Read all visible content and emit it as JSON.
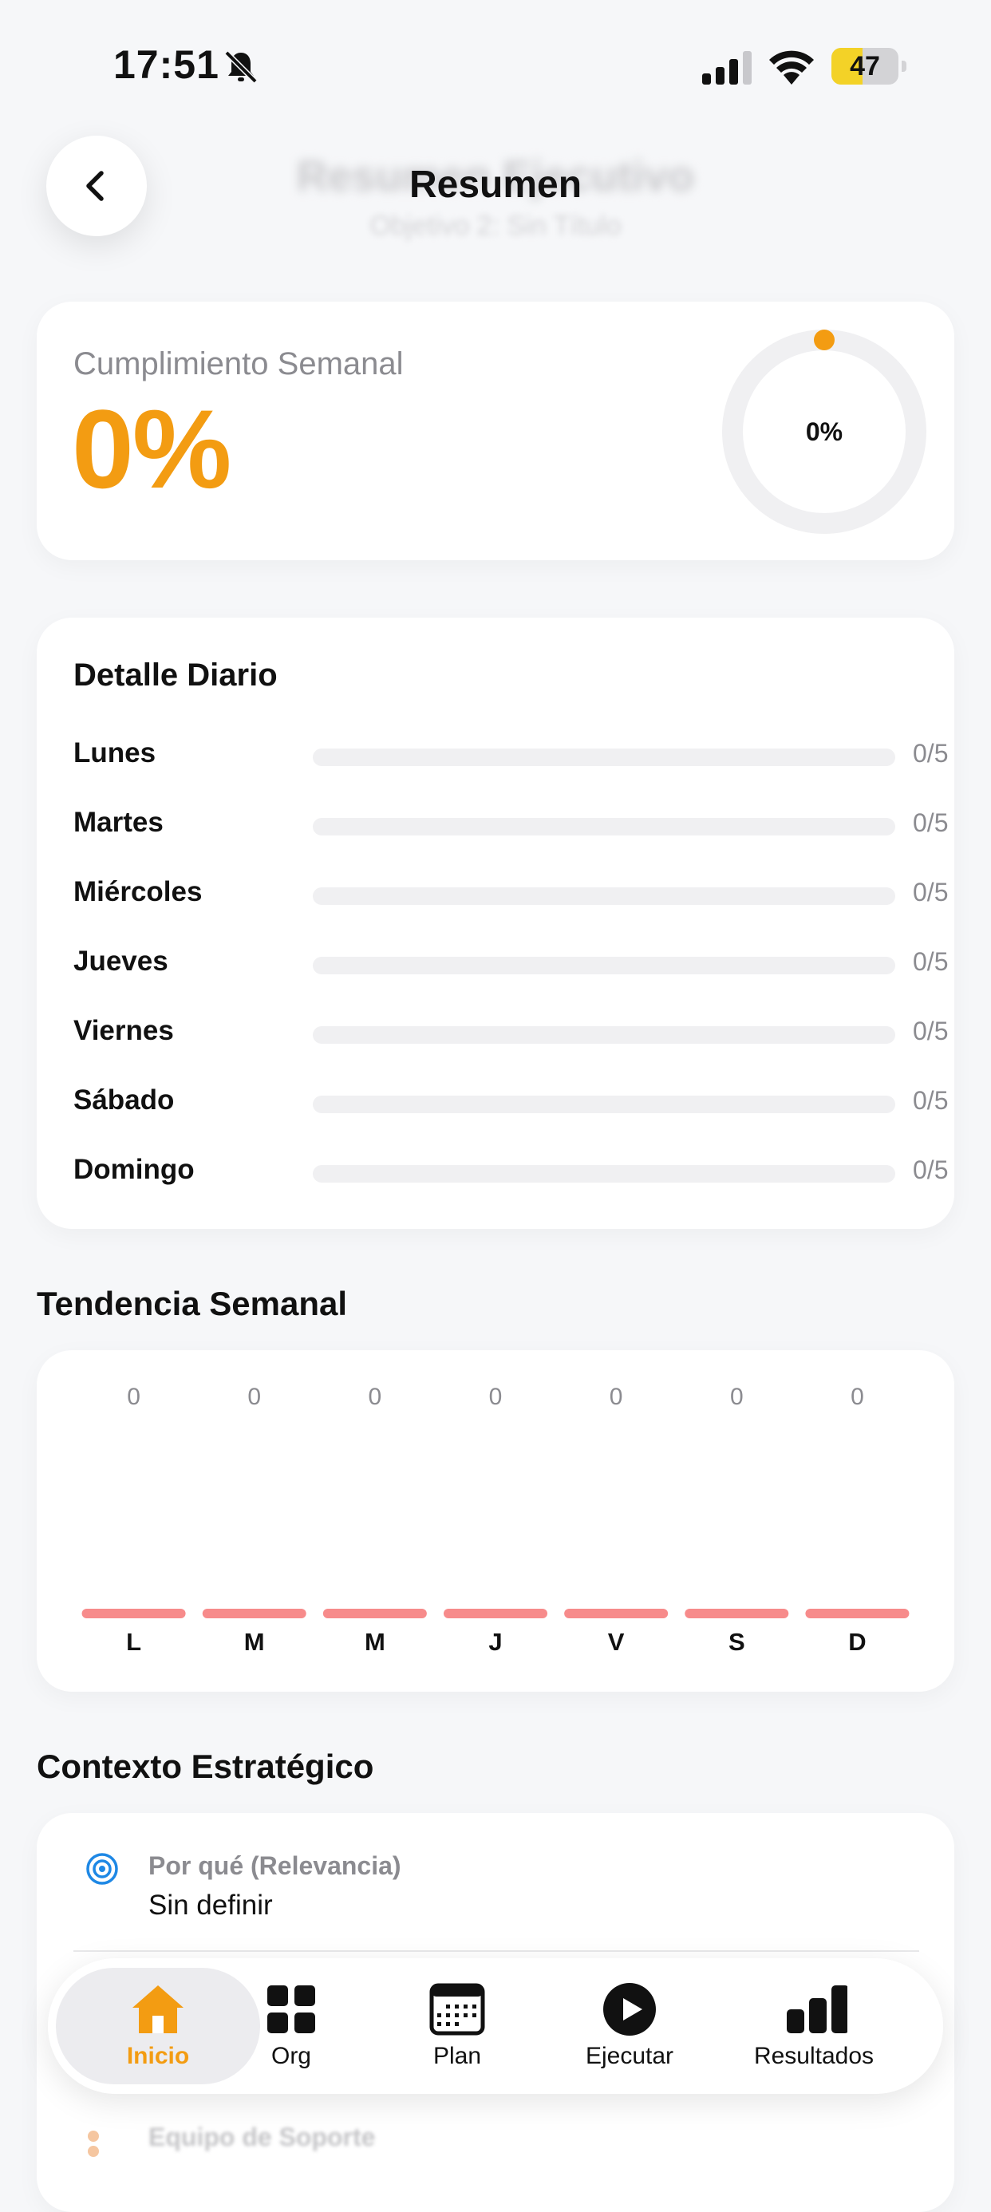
{
  "status_bar": {
    "time": "17:51",
    "battery": "47",
    "battery_level": 0.47
  },
  "header": {
    "title": "Resumen",
    "underlay_title": "Resumen Ejecutivo",
    "underlay_subtitle": "Objetivo 2: Sin Título"
  },
  "weekly": {
    "label": "Cumplimiento Semanal",
    "value": "0%",
    "ring_label": "0%",
    "ring_fraction": 0
  },
  "daily": {
    "title": "Detalle Diario",
    "rows": [
      {
        "day": "Lunes",
        "count": "0/5",
        "fraction": 0
      },
      {
        "day": "Martes",
        "count": "0/5",
        "fraction": 0
      },
      {
        "day": "Miércoles",
        "count": "0/5",
        "fraction": 0
      },
      {
        "day": "Jueves",
        "count": "0/5",
        "fraction": 0
      },
      {
        "day": "Viernes",
        "count": "0/5",
        "fraction": 0
      },
      {
        "day": "Sábado",
        "count": "0/5",
        "fraction": 0
      },
      {
        "day": "Domingo",
        "count": "0/5",
        "fraction": 0
      }
    ]
  },
  "trend": {
    "title": "Tendencia Semanal",
    "bar_color": "#f78b8b"
  },
  "chart_data": {
    "type": "bar",
    "categories": [
      "L",
      "M",
      "M",
      "J",
      "V",
      "S",
      "D"
    ],
    "values": [
      0,
      0,
      0,
      0,
      0,
      0,
      0
    ],
    "value_labels": [
      "0",
      "0",
      "0",
      "0",
      "0",
      "0",
      "0"
    ]
  },
  "context": {
    "title": "Contexto Estratégico",
    "items": [
      {
        "label": "Por qué (Relevancia)",
        "value": "Sin definir"
      }
    ],
    "faded_item_label": "Equipo de Soporte"
  },
  "tabbar": {
    "tabs": [
      {
        "label": "Inicio",
        "icon": "home-icon",
        "active": true
      },
      {
        "label": "Org",
        "icon": "grid-icon"
      },
      {
        "label": "Plan",
        "icon": "calendar-icon"
      },
      {
        "label": "Ejecutar",
        "icon": "play-icon"
      },
      {
        "label": "Resultados",
        "icon": "bar-chart-icon"
      }
    ]
  },
  "colors": {
    "accent": "#f39c12",
    "background": "#f6f7f9",
    "track": "#f0f0f2"
  }
}
